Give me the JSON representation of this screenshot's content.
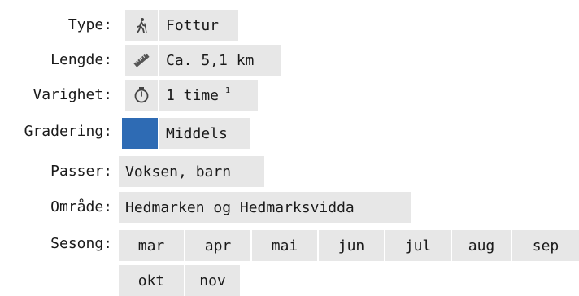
{
  "labels": {
    "type": "Type:",
    "length": "Lengde:",
    "duration": "Varighet:",
    "grade": "Gradering:",
    "suits": "Passer:",
    "area": "Område:",
    "season": "Sesong:"
  },
  "values": {
    "type": "Fottur",
    "length": "Ca. 5,1 km",
    "duration": "1 time",
    "duration_footnote": "1",
    "grade": "Middels",
    "suits": "Voksen, barn",
    "area": "Hedmarken og Hedmarksvidda"
  },
  "icons": {
    "type": "hiker-icon",
    "length": "ruler-icon",
    "duration": "stopwatch-icon"
  },
  "colors": {
    "grade": "#2e6bb4",
    "cell_bg": "#e7e7e7"
  },
  "season": {
    "months": [
      "mar",
      "apr",
      "mai",
      "jun",
      "jul",
      "aug",
      "sep",
      "okt",
      "nov"
    ]
  }
}
